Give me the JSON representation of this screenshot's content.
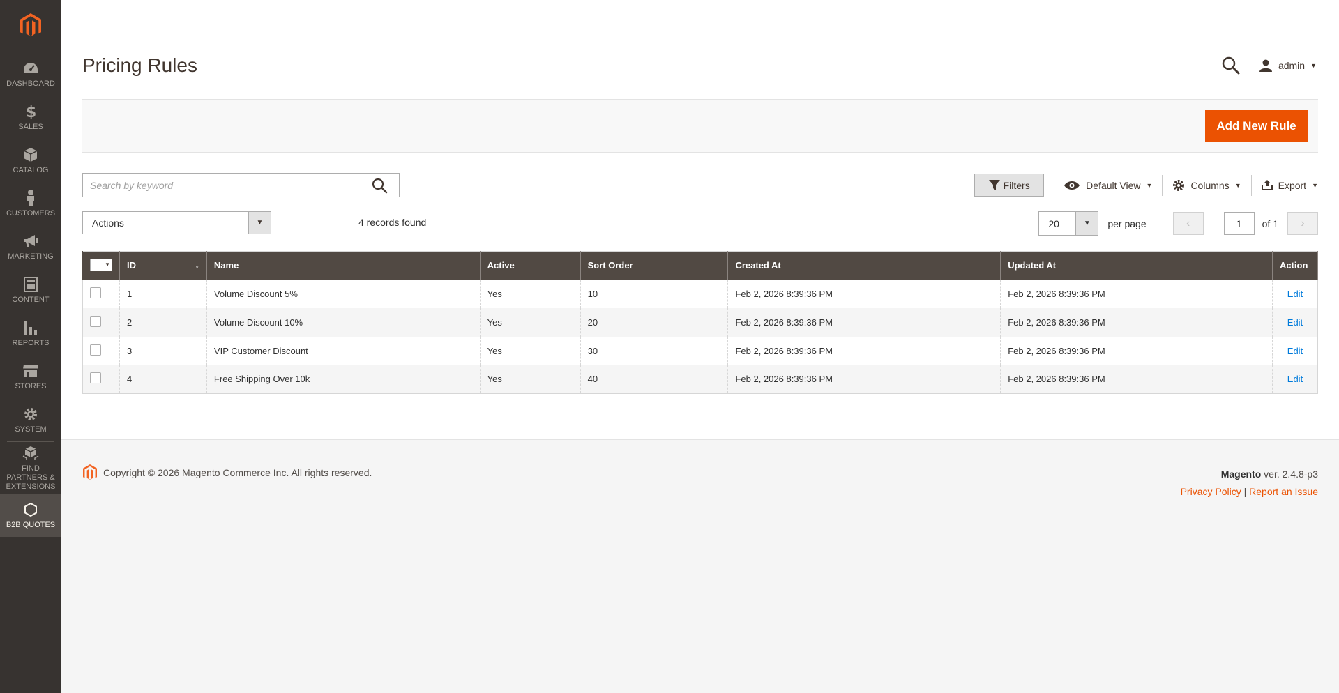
{
  "sidebar": {
    "items": [
      {
        "label": "Dashboard",
        "icon": "dashboard-icon"
      },
      {
        "label": "Sales",
        "icon": "dollar-icon"
      },
      {
        "label": "Catalog",
        "icon": "box-icon"
      },
      {
        "label": "Customers",
        "icon": "person-icon"
      },
      {
        "label": "Marketing",
        "icon": "megaphone-icon"
      },
      {
        "label": "Content",
        "icon": "layout-icon"
      },
      {
        "label": "Reports",
        "icon": "bar-chart-icon"
      },
      {
        "label": "Stores",
        "icon": "store-icon"
      },
      {
        "label": "System",
        "icon": "gear-icon"
      },
      {
        "label": "Find Partners & Extensions",
        "icon": "cubes-icon"
      },
      {
        "label": "B2B Quotes",
        "icon": "hexagon-icon"
      }
    ]
  },
  "header": {
    "title": "Pricing Rules",
    "user": "admin"
  },
  "actions_bar": {
    "add_button": "Add New Rule"
  },
  "toolbar": {
    "search_placeholder": "Search by keyword",
    "filters": "Filters",
    "view": "Default View",
    "columns": "Columns",
    "export": "Export",
    "actions": "Actions",
    "records_found": "4 records found",
    "per_page_value": "20",
    "per_page_label": "per page",
    "current_page": "1",
    "page_of": "of 1"
  },
  "grid": {
    "columns": [
      "ID",
      "Name",
      "Active",
      "Sort Order",
      "Created At",
      "Updated At",
      "Action"
    ],
    "rows": [
      {
        "id": "1",
        "name": "Volume Discount 5%",
        "active": "Yes",
        "sort": "10",
        "created": "Feb 2, 2026 8:39:36 PM",
        "updated": "Feb 2, 2026 8:39:36 PM",
        "action": "Edit"
      },
      {
        "id": "2",
        "name": "Volume Discount 10%",
        "active": "Yes",
        "sort": "20",
        "created": "Feb 2, 2026 8:39:36 PM",
        "updated": "Feb 2, 2026 8:39:36 PM",
        "action": "Edit"
      },
      {
        "id": "3",
        "name": "VIP Customer Discount",
        "active": "Yes",
        "sort": "30",
        "created": "Feb 2, 2026 8:39:36 PM",
        "updated": "Feb 2, 2026 8:39:36 PM",
        "action": "Edit"
      },
      {
        "id": "4",
        "name": "Free Shipping Over 10k",
        "active": "Yes",
        "sort": "40",
        "created": "Feb 2, 2026 8:39:36 PM",
        "updated": "Feb 2, 2026 8:39:36 PM",
        "action": "Edit"
      }
    ]
  },
  "footer": {
    "copyright": "Copyright © 2026 Magento Commerce Inc. All rights reserved.",
    "brand": "Magento",
    "version": "ver. 2.4.8-p3",
    "privacy": "Privacy Policy",
    "separator": "|",
    "report": "Report an Issue"
  },
  "colors": {
    "sidebar_bg": "#373330",
    "accent": "#eb5202",
    "grid_header": "#514943",
    "link": "#007bdb"
  }
}
